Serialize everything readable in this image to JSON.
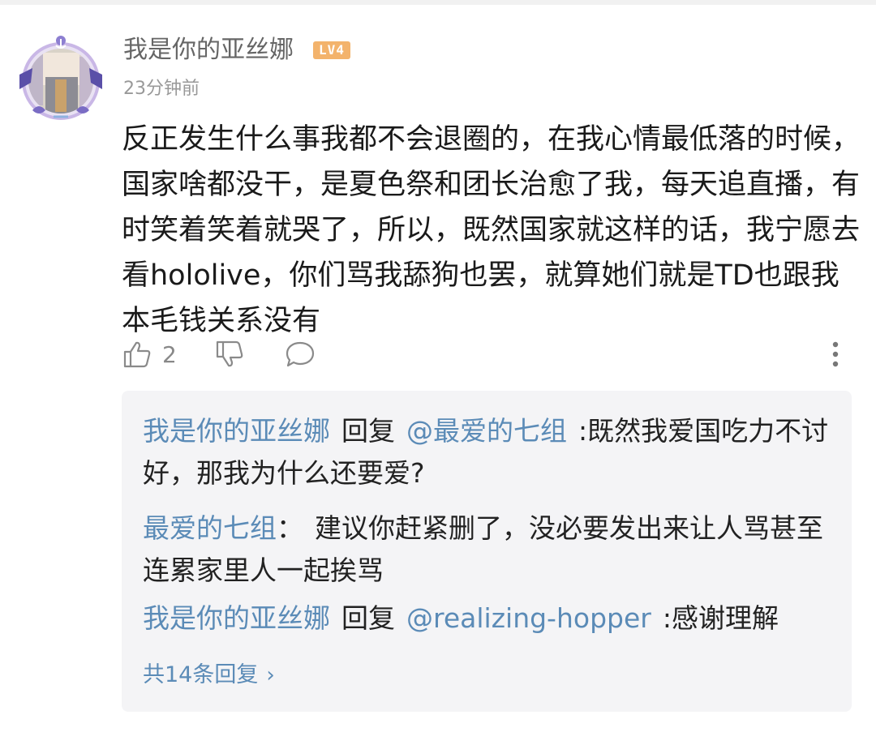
{
  "comment": {
    "author": "我是你的亚丝娜",
    "level_badge": "LV4",
    "time": "23分钟前",
    "text": "反正发生什么事我都不会退圈的，在我心情最低落的时候，国家啥都没干，是夏色祭和团长治愈了我，每天追直播，有时笑着笑着就哭了，所以，既然国家就这样的话，我宁愿去看hololive，你们骂我舔狗也罢，就算她们就是TD也跟我本毛钱关系没有",
    "likes": "2"
  },
  "replies": [
    {
      "author": "我是你的亚丝娜",
      "connector": "回复",
      "mention": "@最爱的七组",
      "separator": ":",
      "text": "既然我爱国吃力不讨好，那我为什么还要爱?"
    },
    {
      "author": "最爱的七组",
      "separator": "：",
      "text": "建议你赶紧删了，没必要发出来让人骂甚至连累家里人一起挨骂"
    },
    {
      "author": "我是你的亚丝娜",
      "connector": "回复",
      "mention": "@realizing-hopper",
      "separator": ":",
      "text": "感谢理解"
    }
  ],
  "more_replies": {
    "label": "共14条回复",
    "chevron": "›"
  },
  "colors": {
    "link": "#5b8bb7",
    "badge": "#f3b36c",
    "reply_bg": "#f4f4f6",
    "muted": "#999999"
  },
  "icons": [
    "thumbs-up-icon",
    "thumbs-down-icon",
    "comment-bubble-icon",
    "more-vertical-icon",
    "chevron-right-icon"
  ]
}
